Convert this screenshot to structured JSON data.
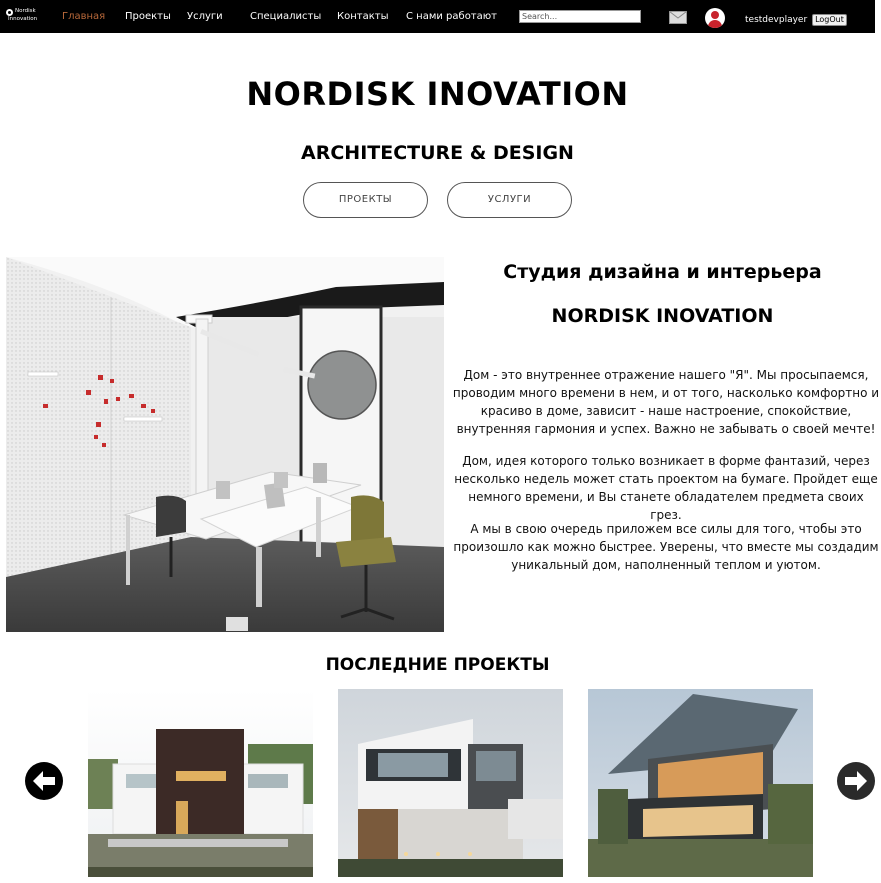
{
  "nav": {
    "logo_line1": "Nordisk",
    "logo_line2": "Innovation",
    "links": [
      {
        "label": "Главная",
        "active": true
      },
      {
        "label": "Проекты"
      },
      {
        "label": "Услуги"
      },
      {
        "label": "Специалисты"
      },
      {
        "label": "Контакты"
      },
      {
        "label": "С нами работают"
      }
    ],
    "search_placeholder": "Search...",
    "username": "testdevplayer",
    "logout_label": "LogOut",
    "icons": {
      "mail": "mail-icon",
      "avatar": "user-avatar-icon"
    },
    "colors": {
      "bar": "#000000",
      "active_link": "#b8683a",
      "avatar": "#c8232c"
    }
  },
  "hero": {
    "title": "NORDISK INOVATION",
    "subtitle": "ARCHITECTURE & DESIGN",
    "buttons": [
      "ПРОЕКТЫ",
      "УСЛУГИ"
    ]
  },
  "studio": {
    "title": "Студия дизайна и интерьера",
    "name": "NORDISK INOVATION",
    "paragraphs": [
      "Дом - это внутреннее отражение нашего \"Я\". Мы просыпаемся, проводим много времени в нем, и от того, насколько комфортно и красиво в доме, зависит - наше настроение, спокойствие, внутренняя гармония и успех. Важно не забывать о своей мечте!",
      "Дом, идея которого только возникает в форме фантазий, через несколько недель может стать проектом на бумаге. Пройдет еще немного времени, и Вы станете обладателем предмета своих грез.",
      "А мы в свою очередь приложем все силы для того, чтобы это произошло как можно быстрее. Уверены, что вместе мы создадим уникальный дом, наполненный теплом и уютом."
    ]
  },
  "projects": {
    "title": "ПОСЛЕДНИЕ ПРОЕКТЫ",
    "icons": {
      "prev": "arrow-left-icon",
      "next": "arrow-right-icon"
    }
  }
}
